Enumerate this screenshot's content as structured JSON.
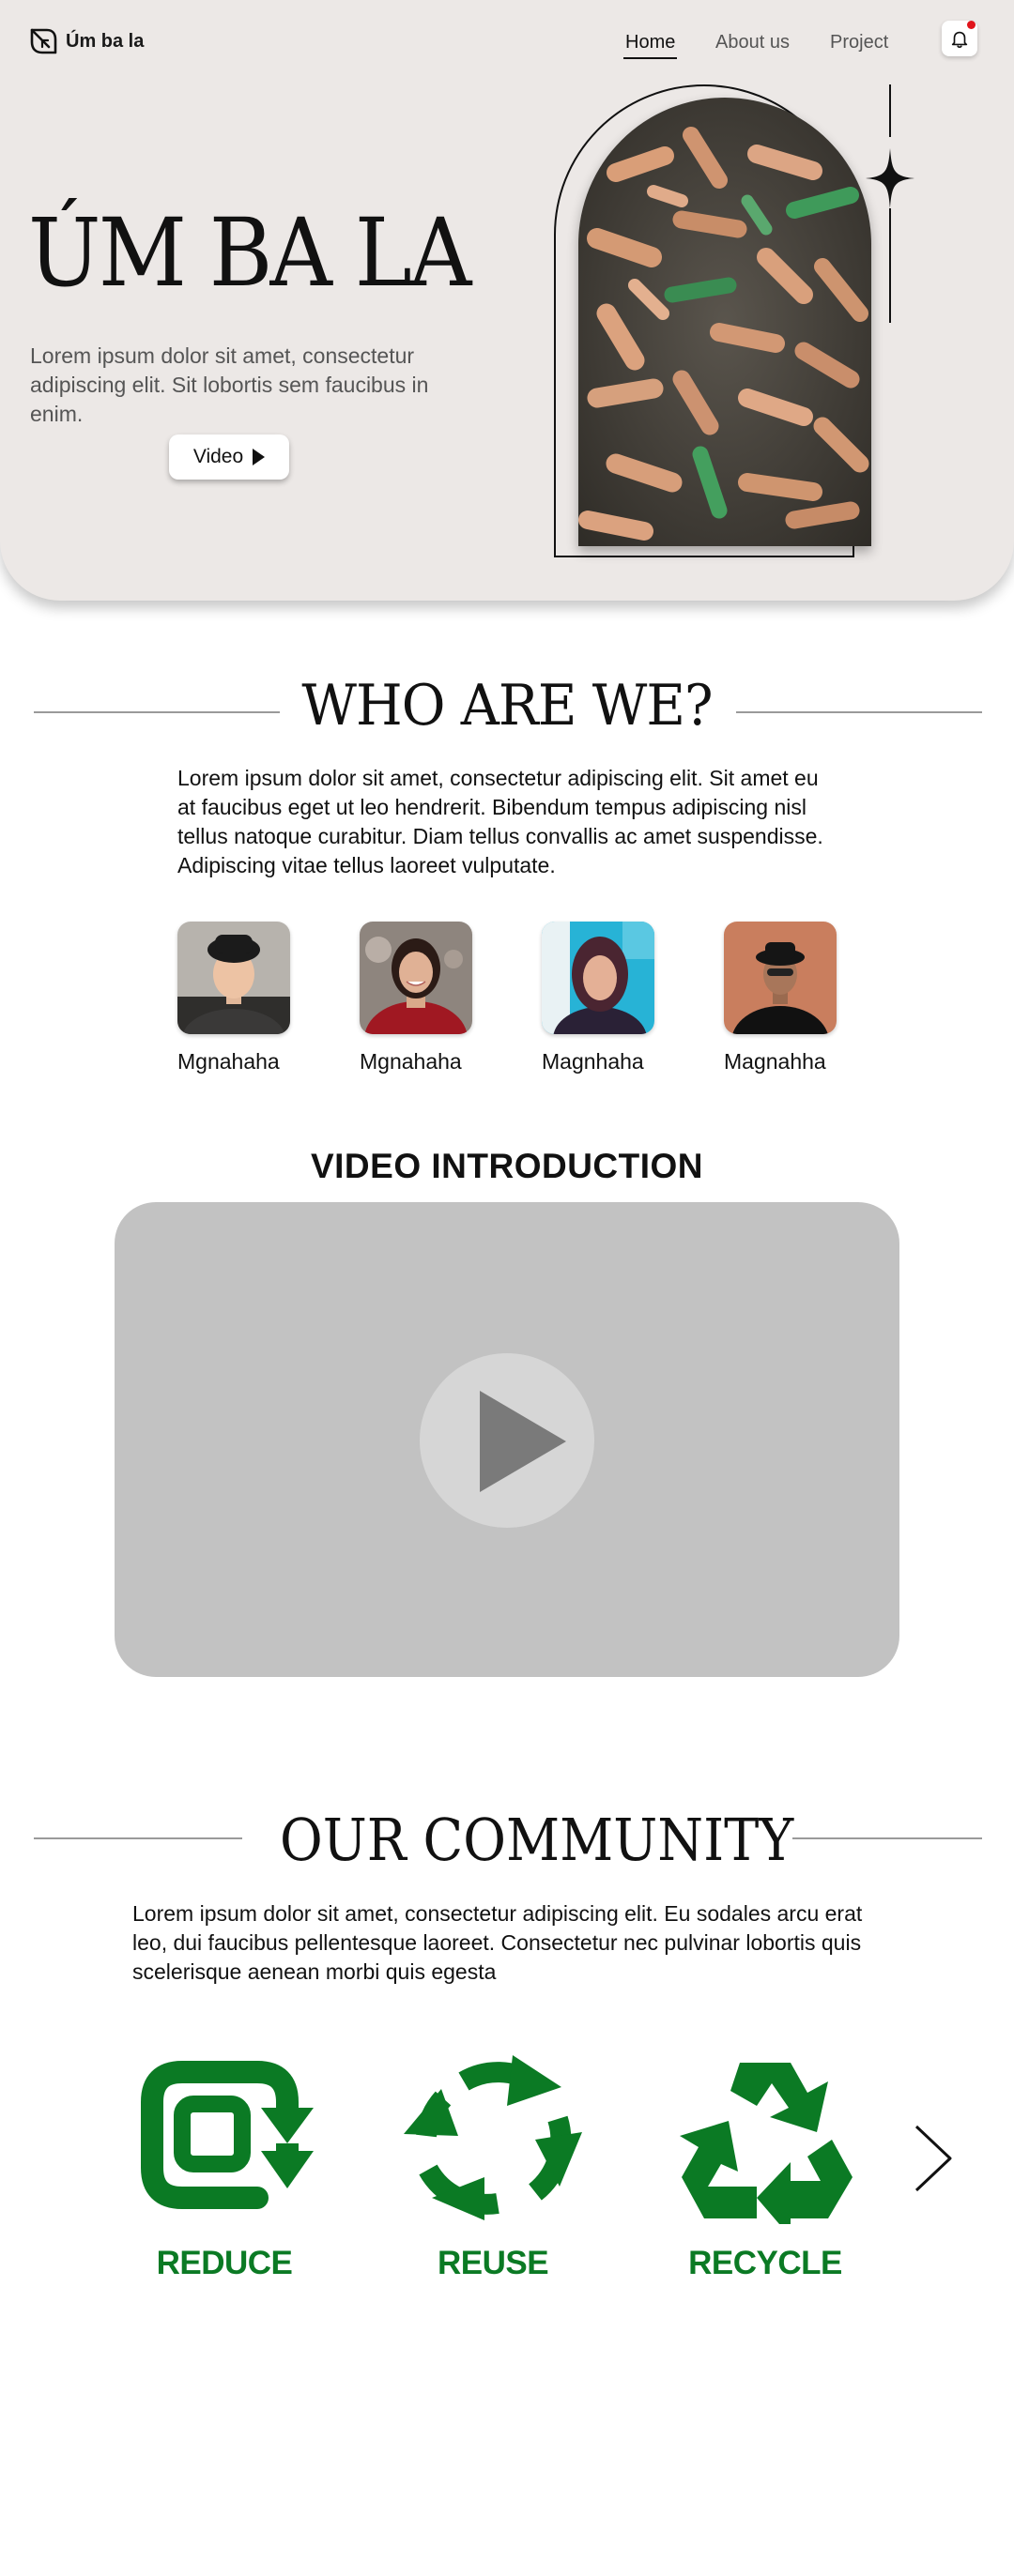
{
  "header": {
    "brand": "Úm ba la",
    "nav": [
      "Home",
      "About us",
      "Project"
    ],
    "active_nav": "Home"
  },
  "hero": {
    "title": "ÚM BA LA",
    "description": "Lorem ipsum dolor sit amet, consectetur adipiscing elit. Sit lobortis sem faucibus in enim.",
    "video_button": "Video"
  },
  "who": {
    "title": "WHO ARE WE?",
    "text": "Lorem ipsum dolor sit amet, consectetur adipiscing elit. Sit amet eu at faucibus eget ut leo hendrerit. Bibendum tempus adipiscing nisl tellus natoque curabitur. Diam tellus convallis ac amet suspendisse. Adipiscing vitae tellus laoreet vulputate.",
    "members": [
      {
        "name": "Mgnahaha"
      },
      {
        "name": "Mgnahaha"
      },
      {
        "name": "Magnhaha"
      },
      {
        "name": "Magnahha"
      }
    ]
  },
  "video": {
    "title": "VIDEO INTRODUCTION"
  },
  "community": {
    "title": "OUR COMMUNITY",
    "text": "Lorem ipsum dolor sit amet, consectetur adipiscing elit. Eu sodales arcu erat leo, dui faucibus pellentesque laoreet. Consectetur nec pulvinar lobortis quis scelerisque aenean morbi quis egesta",
    "items": [
      "REDUCE",
      "REUSE",
      "RECYCLE"
    ]
  },
  "colors": {
    "hero_bg": "#ece8e6",
    "green": "#0b7a24",
    "video_bg": "#c2c2c2",
    "notification": "#e0141b"
  },
  "icons": [
    "leaf-logo-icon",
    "bell-icon",
    "play-icon",
    "sparkle-icon",
    "reduce-icon",
    "reuse-icon",
    "recycle-icon",
    "chevron-right-icon"
  ]
}
